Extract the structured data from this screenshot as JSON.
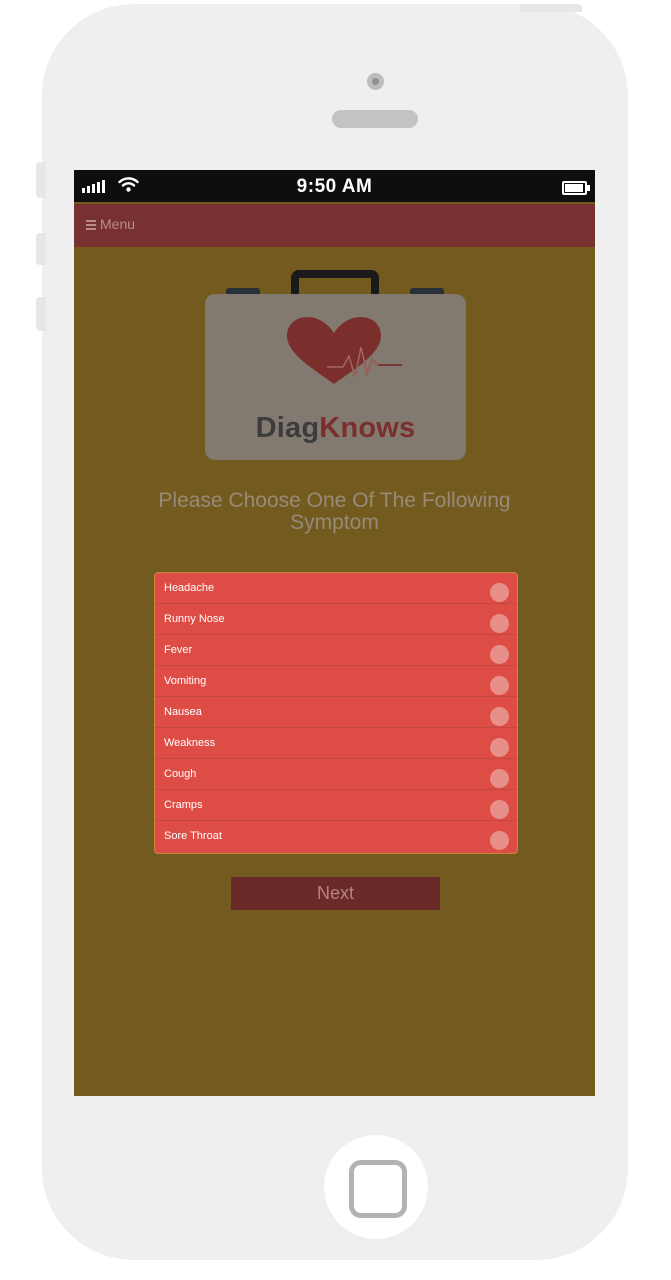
{
  "status_bar": {
    "time": "9:50 AM",
    "signal_icon": "signal-bars-icon",
    "wifi_icon": "wifi-icon",
    "battery_icon": "battery-icon"
  },
  "nav": {
    "menu_label": "Menu",
    "menu_icon": "hamburger-icon"
  },
  "logo": {
    "text_part1": "Diag",
    "text_part2": "Knows",
    "icon": "medical-briefcase-heart-icon"
  },
  "prompt": {
    "text": "Please Choose One Of The Following Symptom"
  },
  "symptoms": [
    {
      "label": "Headache",
      "selected": false
    },
    {
      "label": "Runny Nose",
      "selected": false
    },
    {
      "label": "Fever",
      "selected": false
    },
    {
      "label": "Vomiting",
      "selected": false
    },
    {
      "label": "Nausea",
      "selected": false
    },
    {
      "label": "Weakness",
      "selected": false
    },
    {
      "label": "Cough",
      "selected": false
    },
    {
      "label": "Cramps",
      "selected": false
    },
    {
      "label": "Sore Throat",
      "selected": false
    }
  ],
  "actions": {
    "next_label": "Next"
  },
  "colors": {
    "background": "#735a1e",
    "nav_bar": "#773130",
    "list_bg": "#de4d45",
    "next_button": "#6a2a27",
    "logo_heart": "#7a2f2c"
  }
}
